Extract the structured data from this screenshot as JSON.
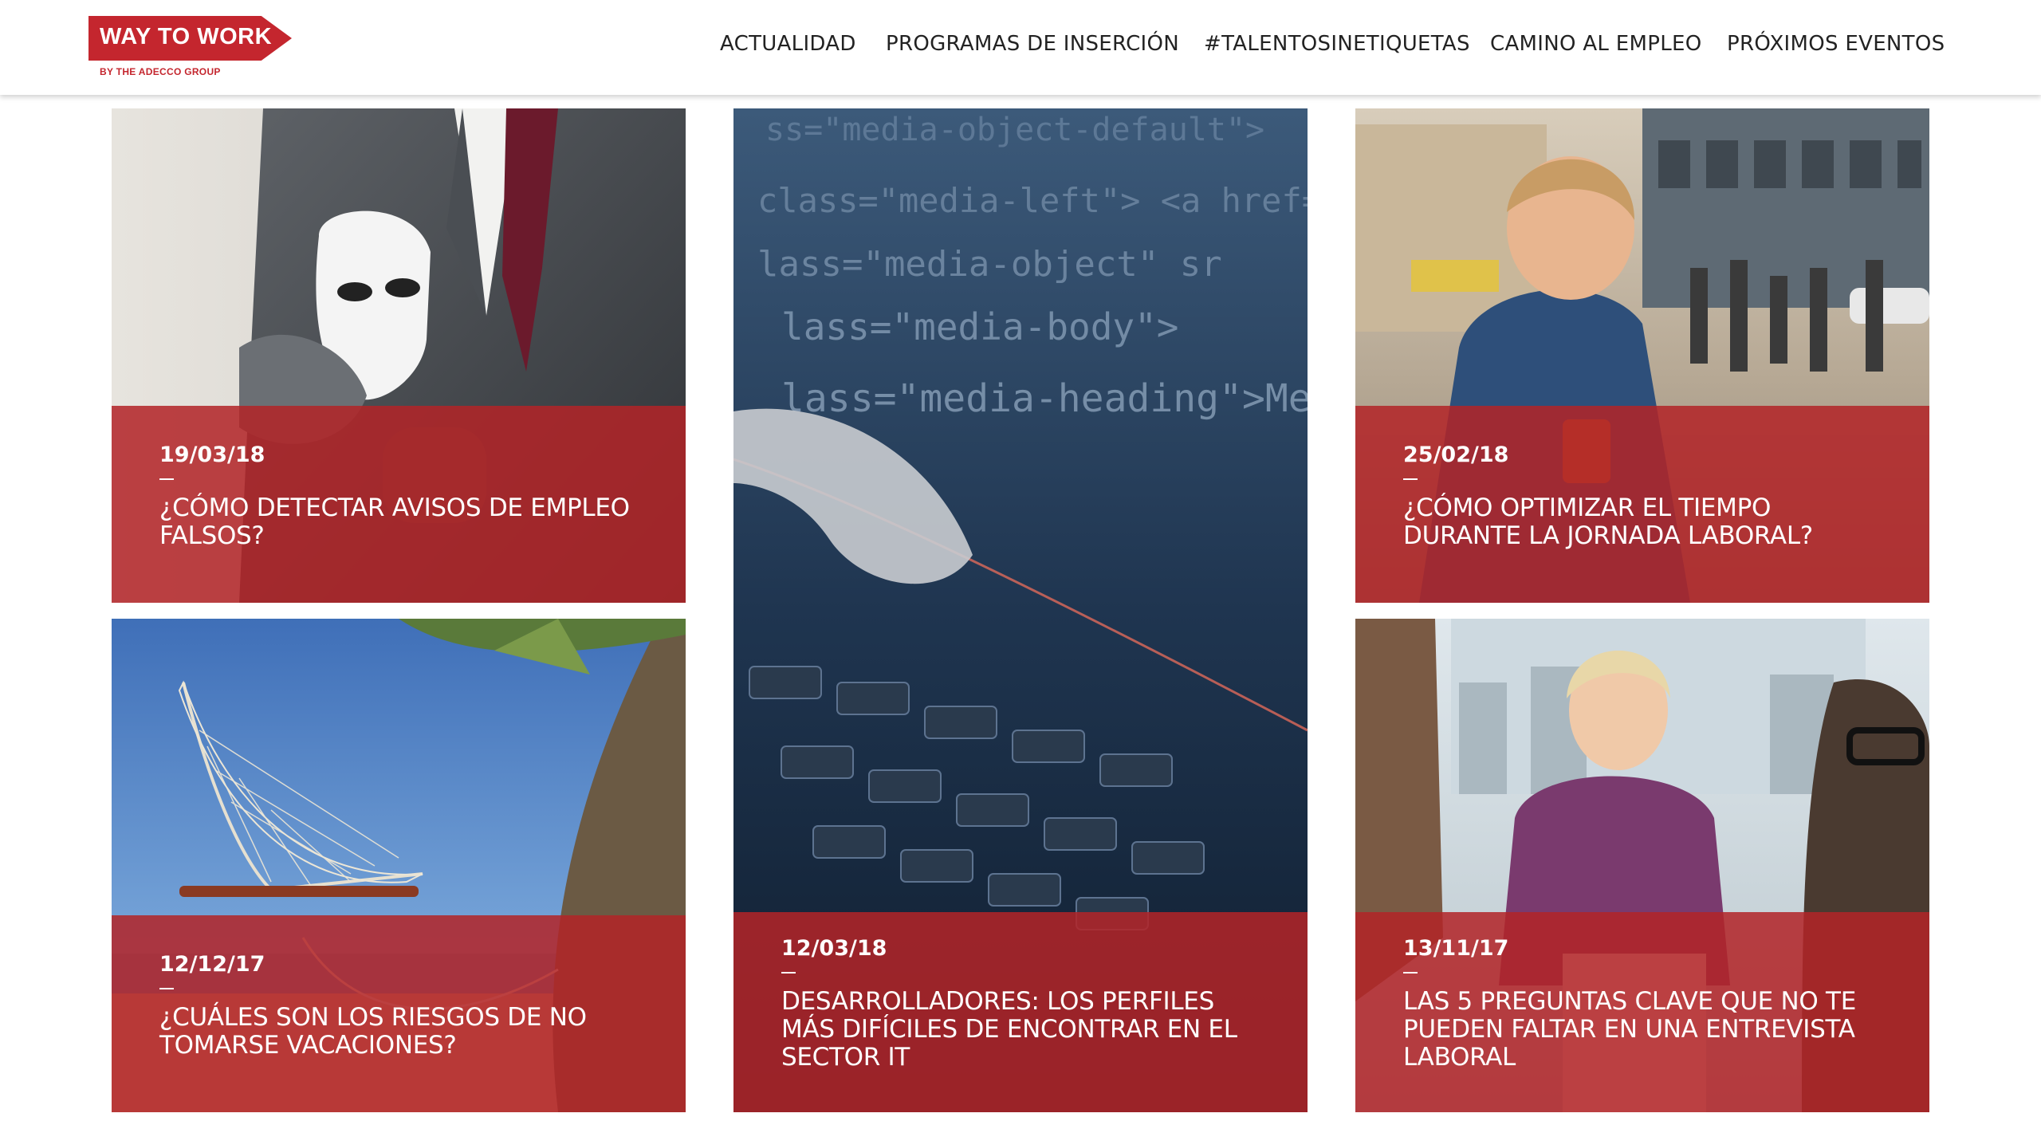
{
  "brand": {
    "title": "WAY TO WORK",
    "subtitle": "BY THE ADECCO GROUP",
    "color": "#c4262e"
  },
  "nav": {
    "items": [
      {
        "label": "ACTUALIDAD"
      },
      {
        "label": "PROGRAMAS DE INSERCIÓN"
      },
      {
        "label": "#TALENTOSINETIQUETAS"
      },
      {
        "label": "CAMINO AL EMPLEO"
      },
      {
        "label": "PRÓXIMOS EVENTOS"
      }
    ]
  },
  "articles": [
    {
      "date": "19/03/18",
      "title": "¿CÓMO DETECTAR AVISOS DE EMPLEO FALSOS?",
      "image": "man-in-suit-holding-mask"
    },
    {
      "date": "12/03/18",
      "title": "DESARROLLADORES: LOS PERFILES MÁS DIFÍCILES DE ENCONTRAR EN EL SECTOR IT",
      "image": "code-on-screen-and-keyboard"
    },
    {
      "date": "25/02/18",
      "title": "¿CÓMO OPTIMIZAR EL TIEMPO DURANTE LA JORNADA LABORAL?",
      "image": "woman-on-phone-in-street"
    },
    {
      "date": "12/12/17",
      "title": "¿CUÁLES SON LOS RIESGOS DE NO TOMARSE VACACIONES?",
      "image": "hammocks-on-beach"
    },
    {
      "date": "13/11/17",
      "title": "LAS 5 PREGUNTAS CLAVE QUE NO TE PUEDEN FALTAR EN UNA ENTREVISTA LABORAL",
      "image": "job-interview"
    }
  ],
  "overlay_color": "#b22428"
}
